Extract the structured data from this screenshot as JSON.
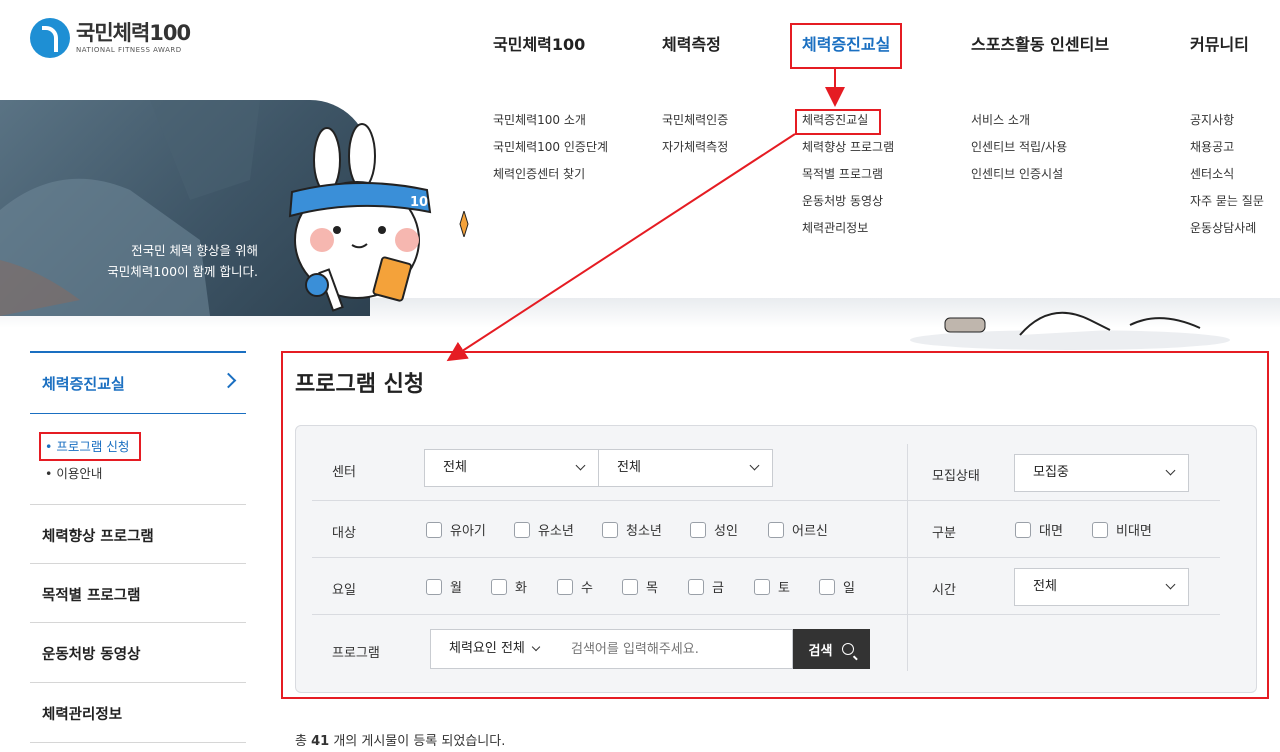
{
  "header": {
    "logo_title": "국민체력100",
    "logo_sub": "NATIONAL FITNESS AWARD",
    "nav": [
      {
        "label": "국민체력100"
      },
      {
        "label": "체력측정"
      },
      {
        "label": "체력증진교실"
      },
      {
        "label": "스포츠활동 인센티브"
      },
      {
        "label": "커뮤니티"
      }
    ]
  },
  "megamenu": {
    "col1": [
      "국민체력100 소개",
      "국민체력100 인증단계",
      "체력인증센터 찾기"
    ],
    "col2": [
      "국민체력인증",
      "자가체력측정"
    ],
    "col3": [
      "체력증진교실",
      "체력향상 프로그램",
      "목적별 프로그램",
      "운동처방 동영상",
      "체력관리정보"
    ],
    "col4": [
      "서비스 소개",
      "인센티브 적립/사용",
      "인센티브 인증시설"
    ],
    "col5": [
      "공지사항",
      "채용공고",
      "센터소식",
      "자주 묻는 질문",
      "운동상담사례"
    ]
  },
  "hero": {
    "line1": "전국민 체력 향상을 위해",
    "line2": "국민체력100이 함께 합니다."
  },
  "lnb": {
    "current": "체력증진교실",
    "subs": [
      "• 프로그램 신청",
      "• 이용안내"
    ],
    "items": [
      "체력향상 프로그램",
      "목적별 프로그램",
      "운동처방 동영상",
      "체력관리정보"
    ]
  },
  "content": {
    "title": "프로그램 신청",
    "labels": {
      "center": "센터",
      "target": "대상",
      "day": "요일",
      "program": "프로그램",
      "status": "모집상태",
      "type": "구분",
      "time": "시간"
    },
    "center_select1": "전체",
    "center_select2": "전체",
    "status_select": "모집중",
    "time_select": "전체",
    "targets": [
      "유아기",
      "유소년",
      "청소년",
      "성인",
      "어르신"
    ],
    "types": [
      "대면",
      "비대면"
    ],
    "days": [
      "월",
      "화",
      "수",
      "목",
      "금",
      "토",
      "일"
    ],
    "program_select": "체력요인 전체",
    "search_placeholder": "검색어를 입력해주세요.",
    "search_button": "검색",
    "count_prefix": "총 ",
    "count_value": "41",
    "count_suffix": " 개의 게시물이 등록 되었습니다."
  },
  "colors": {
    "accent": "#1a6fc1",
    "annotation": "#e51c23"
  }
}
